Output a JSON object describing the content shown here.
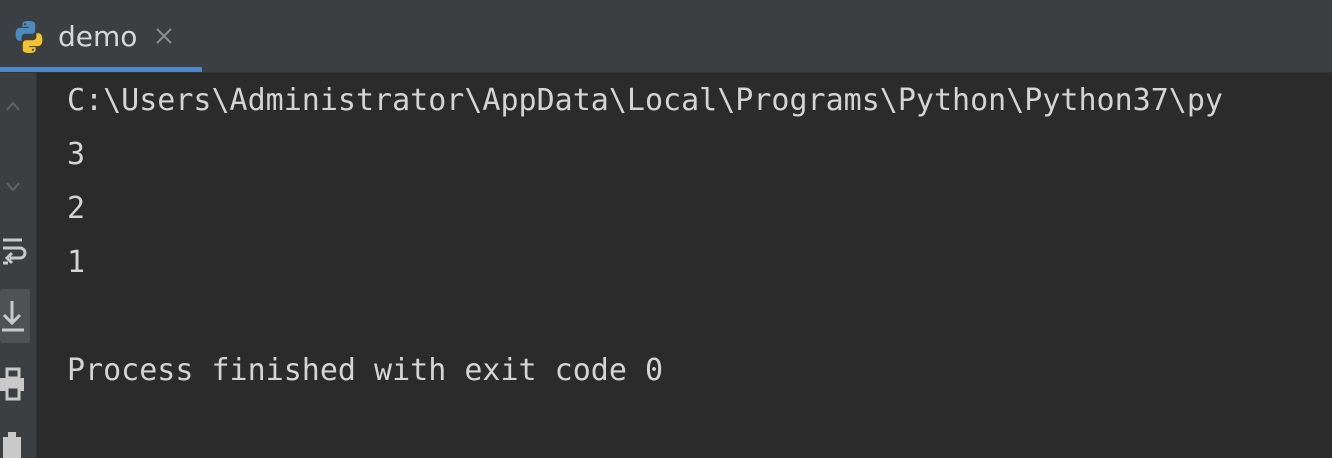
{
  "tab": {
    "title": "demo",
    "icon": "python-file-icon",
    "active": true
  },
  "toolbar": {
    "tools": [
      "up-arrow-icon",
      "down-arrow-icon",
      "soft-wrap-icon",
      "scroll-to-end-icon",
      "print-icon",
      "clear-icon"
    ]
  },
  "console": {
    "lines": [
      "C:\\Users\\Administrator\\AppData\\Local\\Programs\\Python\\Python37\\py",
      "3",
      "2",
      "1",
      "",
      "Process finished with exit code 0"
    ]
  },
  "colors": {
    "background": "#2b2b2b",
    "panel": "#3c3f41",
    "accent": "#4a88c7",
    "text": "#d4d4d4"
  }
}
